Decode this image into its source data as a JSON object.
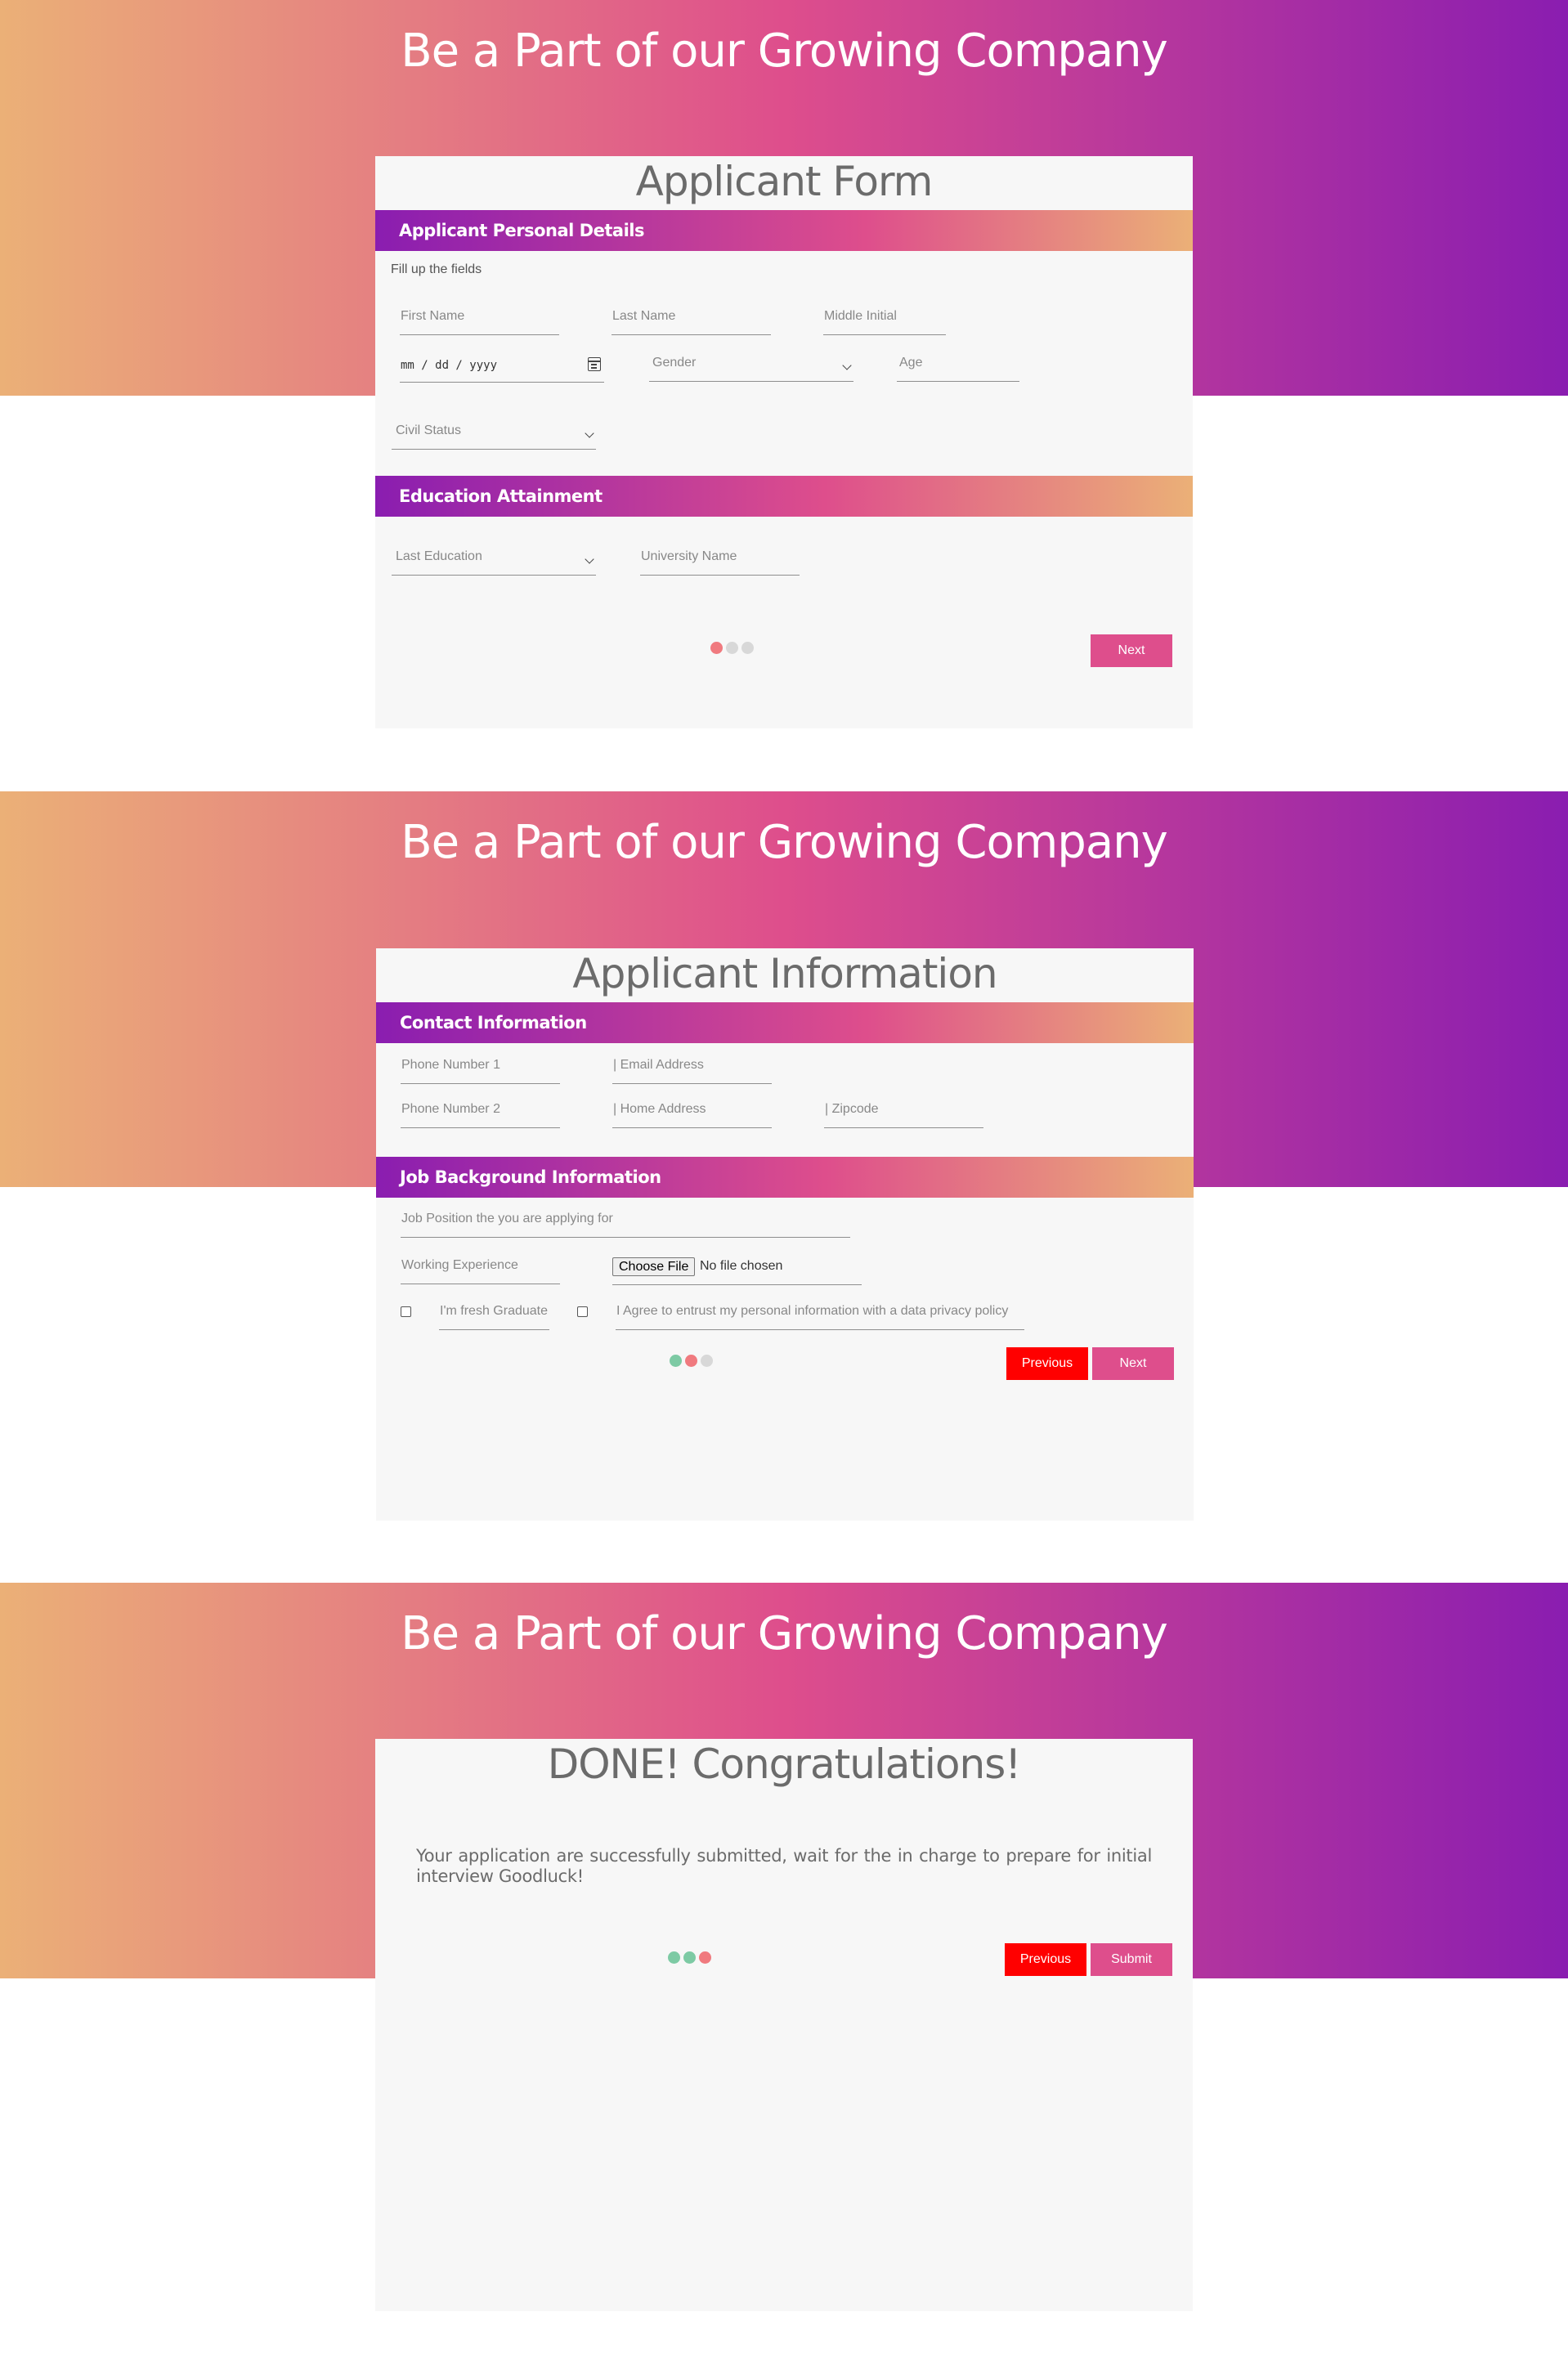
{
  "screen1": {
    "banner_title": "Be a Part of our Growing Company",
    "card_title": "Applicant Form",
    "personal_bar": "Applicant Personal Details",
    "hint": "Fill up the fields",
    "first_name": "First Name",
    "last_name": "Last Name",
    "middle_initial": "Middle Initial",
    "date_placeholder": "mm / dd / yyyy",
    "gender": "Gender",
    "age": "Age",
    "civil_status": "Civil Status",
    "education_bar": "Education Attainment",
    "last_education": "Last Education",
    "university_name": "University Name",
    "next_label": "Next",
    "step_colors": [
      "#f07a7f",
      "#d8d8d8",
      "#d8d8d8"
    ]
  },
  "screen2": {
    "banner_title": "Be a Part of our Growing Company",
    "card_title": "Applicant Information",
    "contact_bar": "Contact Information",
    "phone1": "Phone Number 1",
    "email": "| Email Address",
    "phone2": "Phone Number 2",
    "home_address": "| Home Address",
    "zipcode": "| Zipcode",
    "job_bar": "Job Background Information",
    "job_position": "Job Position the you are applying for",
    "working_experience": "Working Experience",
    "choose_file": "Choose File",
    "no_file": "No file chosen",
    "fresh_graduate": "I'm fresh Graduate",
    "agree": "I Agree to entrust my personal information with a data privacy policy",
    "previous_label": "Previous",
    "next_label": "Next",
    "step_colors": [
      "#7dcaa4",
      "#f07a7f",
      "#d8d8d8"
    ]
  },
  "screen3": {
    "banner_title": "Be a Part of our Growing Company",
    "card_title": "DONE! Congratulations!",
    "message": "Your application are successfully submitted, wait for the in charge to prepare for initial interview Goodluck!",
    "previous_label": "Previous",
    "submit_label": "Submit",
    "step_colors": [
      "#7dcaa4",
      "#7dcaa4",
      "#f07a7f"
    ]
  },
  "colors": {
    "gradient_start": "#ebb077",
    "gradient_mid": "#de4e8c",
    "gradient_end": "#8a1db0",
    "next_button": "#de4e8c",
    "previous_button": "#ff0000",
    "step_active": "#f07a7f",
    "step_done": "#7dcaa4",
    "step_pending": "#d8d8d8"
  },
  "icons": [
    "calendar-icon",
    "chevron-down-icon"
  ]
}
